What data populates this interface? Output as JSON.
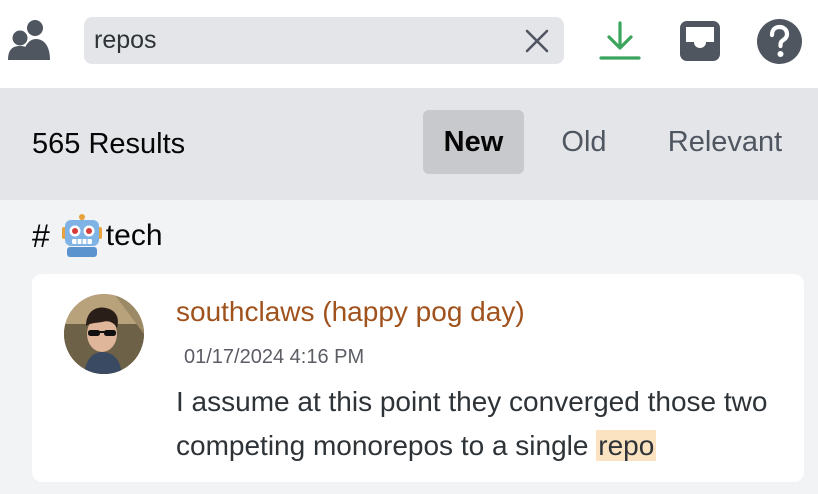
{
  "search": {
    "value": "repos"
  },
  "results": {
    "count_label": "565 Results",
    "sort_tabs": [
      {
        "label": "New",
        "active": true
      },
      {
        "label": "Old",
        "active": false
      },
      {
        "label": "Relevant",
        "active": false
      }
    ]
  },
  "channel": {
    "hash": "#",
    "emoji_icon": "robot-icon",
    "name": "tech"
  },
  "message": {
    "author": "southclaws (happy pog day)",
    "timestamp": "01/17/2024 4:16 PM",
    "text_before": "I assume at this point they converged those two competing monorepos to a single ",
    "highlighted_term": "repo"
  },
  "colors": {
    "author": "#a0521d",
    "download_icon": "#3ba55d",
    "highlight": "#fbe3c2",
    "results_bar_bg": "#e3e5e8"
  },
  "icons": [
    "members-icon",
    "close-icon",
    "download-icon",
    "inbox-icon",
    "help-icon"
  ]
}
